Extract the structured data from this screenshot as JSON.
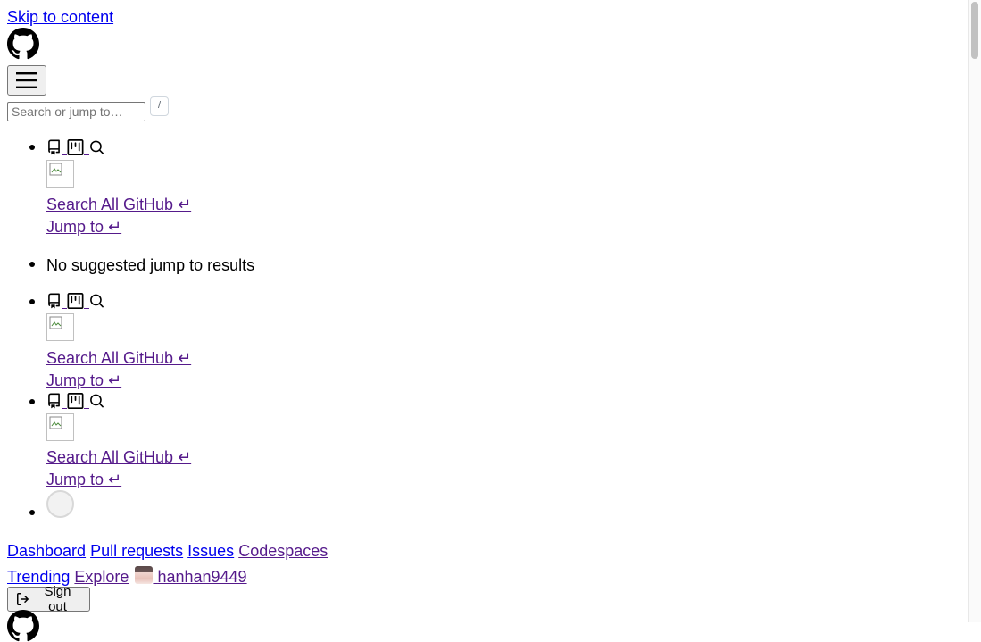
{
  "header": {
    "skip_link": "Skip to content",
    "search": {
      "placeholder": "Search or jump to…",
      "shortcut_key": "/"
    }
  },
  "jump_suggestions": {
    "search_all_label": "Search All GitHub ↵",
    "jump_to_label": "Jump to ↵",
    "no_results_text": "No suggested jump to results"
  },
  "nav": {
    "dashboard": "Dashboard",
    "pull_requests": "Pull requests",
    "issues": "Issues",
    "codespaces": "Codespaces",
    "trending": "Trending",
    "explore": "Explore",
    "username": "hanhan9449",
    "sign_out": "Sign out"
  },
  "icons": {
    "logo": "github-mark-icon",
    "menu": "hamburger-icon",
    "repo": "repo-icon",
    "project": "project-icon",
    "search": "search-icon",
    "sign_out": "sign-out-icon"
  },
  "colors": {
    "link": "#0000ee",
    "visited_link": "#551a8b",
    "button_bg": "#efefef"
  }
}
